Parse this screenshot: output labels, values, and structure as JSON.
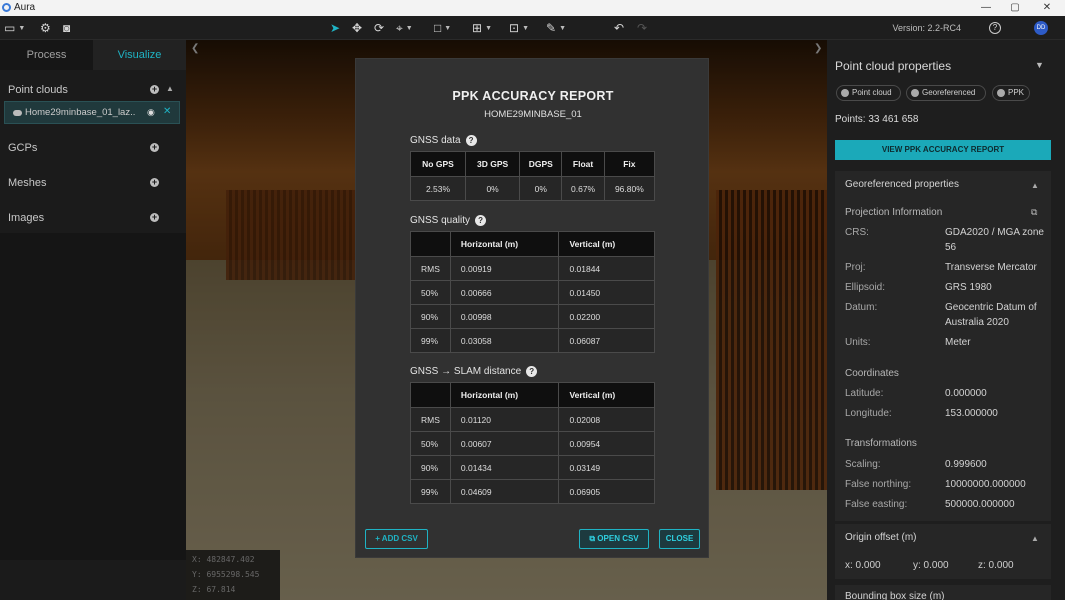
{
  "window": {
    "title": "Aura",
    "minimize": "—",
    "maximize": "▢",
    "close": "✕"
  },
  "toolbar": {
    "version": "Version: 2.2-RC4",
    "help": "?",
    "avatar": "DD"
  },
  "left_panel": {
    "tabs": [
      {
        "label": "Process"
      },
      {
        "label": "Visualize"
      }
    ],
    "sections": [
      {
        "label": "Point clouds"
      },
      {
        "label": "GCPs"
      },
      {
        "label": "Meshes"
      },
      {
        "label": "Images"
      }
    ],
    "layer": {
      "name": "Home29minbase_01_laz..."
    }
  },
  "viewport": {
    "coords": {
      "x": "X: 482847.402",
      "y": "Y: 6955298.545",
      "z": "Z: 67.814"
    }
  },
  "report": {
    "title": "PPK ACCURACY REPORT",
    "subtitle": "HOME29MINBASE_01",
    "gnss_data": {
      "heading": "GNSS data",
      "headers": [
        "No GPS",
        "3D GPS",
        "DGPS",
        "Float",
        "Fix"
      ],
      "values": [
        "2.53%",
        "0%",
        "0%",
        "0.67%",
        "96.80%"
      ]
    },
    "gnss_quality": {
      "heading": "GNSS quality",
      "headers": [
        "",
        "Horizontal (m)",
        "Vertical (m)"
      ],
      "rows": [
        [
          "RMS",
          "0.00919",
          "0.01844"
        ],
        [
          "50%",
          "0.00666",
          "0.01450"
        ],
        [
          "90%",
          "0.00998",
          "0.02200"
        ],
        [
          "99%",
          "0.03058",
          "0.06087"
        ]
      ]
    },
    "slam_distance": {
      "heading": "GNSS → SLAM distance",
      "headers": [
        "",
        "Horizontal (m)",
        "Vertical (m)"
      ],
      "rows": [
        [
          "RMS",
          "0.01120",
          "0.02008"
        ],
        [
          "50%",
          "0.00607",
          "0.00954"
        ],
        [
          "90%",
          "0.01434",
          "0.03149"
        ],
        [
          "99%",
          "0.04609",
          "0.06905"
        ]
      ]
    },
    "buttons": {
      "add_csv": "+ ADD CSV",
      "open_csv": "OPEN CSV",
      "close": "CLOSE"
    }
  },
  "right_panel": {
    "title": "Point cloud properties",
    "chips": [
      {
        "label": "Point cloud"
      },
      {
        "label": "Georeferenced"
      },
      {
        "label": "PPK"
      }
    ],
    "points": "Points: 33 461 658",
    "view_report_button": "VIEW PPK ACCURACY REPORT",
    "georef": {
      "heading": "Georeferenced properties",
      "projection_heading": "Projection Information",
      "crs_label": "CRS:",
      "crs_value": "GDA2020 / MGA zone 56",
      "proj_label": "Proj:",
      "proj_value": "Transverse Mercator",
      "ellipsoid_label": "Ellipsoid:",
      "ellipsoid_value": "GRS 1980",
      "datum_label": "Datum:",
      "datum_value": "Geocentric Datum of Australia 2020",
      "units_label": "Units:",
      "units_value": "Meter",
      "coords_heading": "Coordinates",
      "lat_label": "Latitude:",
      "lat_value": "0.000000",
      "lon_label": "Longitude:",
      "lon_value": "153.000000",
      "transform_heading": "Transformations",
      "scaling_label": "Scaling:",
      "scaling_value": "0.999600",
      "fn_label": "False northing:",
      "fn_value": "10000000.000000",
      "fe_label": "False easting:",
      "fe_value": "500000.000000"
    },
    "origin_offset": {
      "heading": "Origin offset (m)",
      "x": "x: 0.000",
      "y": "y: 0.000",
      "z": "z: 0.000"
    },
    "bounding_box": {
      "heading": "Bounding box size (m)"
    }
  },
  "colors": {
    "accent": "#1fb3c4",
    "panel": "#1e1e1e",
    "modal": "#313131"
  }
}
